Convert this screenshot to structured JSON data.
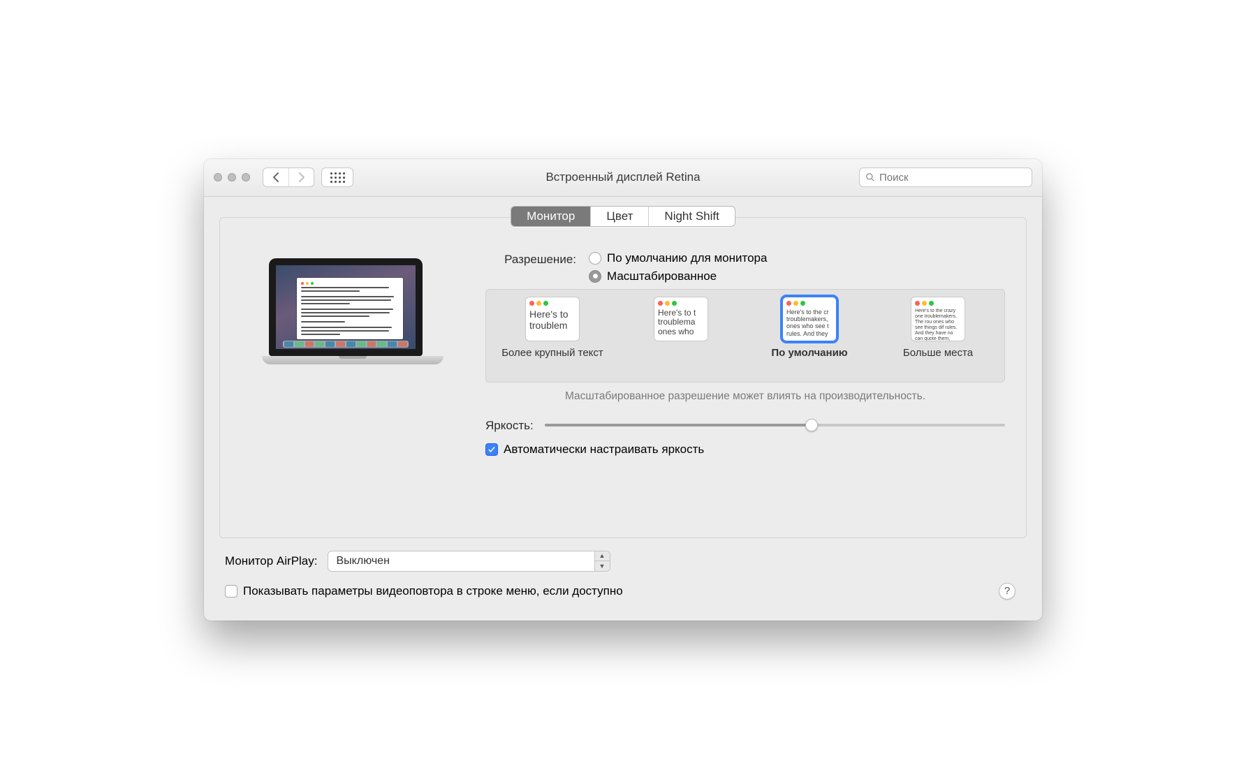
{
  "window": {
    "title": "Встроенный дисплей Retina"
  },
  "search": {
    "placeholder": "Поиск"
  },
  "tabs": {
    "monitor": "Монитор",
    "color": "Цвет",
    "nightshift": "Night Shift",
    "active": "monitor"
  },
  "resolution": {
    "label": "Разрешение:",
    "default_opt": "По умолчанию для монитора",
    "scaled_opt": "Масштабированное",
    "selected": "scaled",
    "thumbs": [
      {
        "label": "Более крупный текст",
        "sample": "Here's to troublem",
        "font_px": 14
      },
      {
        "label": "",
        "sample": "Here's to t troublema ones who",
        "font_px": 12
      },
      {
        "label": "По умолчанию",
        "sample": "Here's to the cr troublemakers, ones who see t rules. And they",
        "font_px": 9,
        "selected": true
      },
      {
        "label": "Больше места",
        "sample": "Here's to the crazy one troublemakers. The rou ones who see things dif rules. And they have no can quote them, disagr them. About the only th Because they change t",
        "font_px": 7
      }
    ],
    "note": "Масштабированное разрешение может влиять на производительность."
  },
  "brightness": {
    "label": "Яркость:",
    "value_pct": 58,
    "auto_label": "Автоматически настраивать яркость",
    "auto_checked": true
  },
  "airplay": {
    "label": "Монитор AirPlay:",
    "value": "Выключен"
  },
  "mirror": {
    "label": "Показывать параметры видеоповтора в строке меню, если доступно",
    "checked": false
  }
}
